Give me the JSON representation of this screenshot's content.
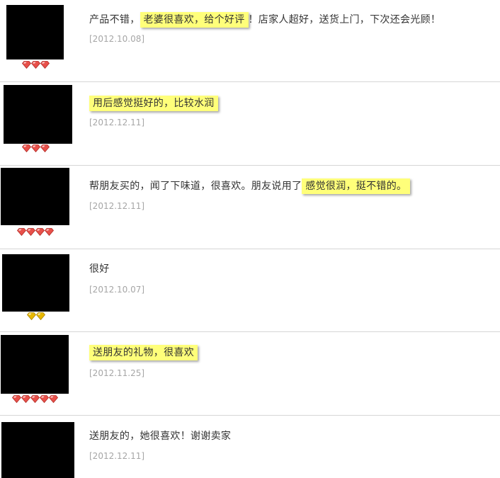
{
  "reviews": [
    {
      "parts": [
        "产品不错，",
        "老婆很喜欢，给个好评",
        "！店家人超好，送货上门，下次还会光顾！"
      ],
      "highlight_index": 1,
      "date": "[2012.10.08]",
      "badge": {
        "type": "red-diamond",
        "count": 3
      }
    },
    {
      "parts": [
        "",
        "用后感觉挺好的，比较水润",
        ""
      ],
      "highlight_index": 1,
      "date": "[2012.12.11]",
      "badge": {
        "type": "red-diamond",
        "count": 3
      }
    },
    {
      "parts": [
        "帮朋友买的，闻了下味道，很喜欢。朋友说用了",
        "感觉很润，挺不错的。",
        ""
      ],
      "highlight_index": 1,
      "date": "[2012.12.11]",
      "badge": {
        "type": "red-diamond",
        "count": 4
      }
    },
    {
      "parts": [
        "很好",
        "",
        ""
      ],
      "highlight_index": -1,
      "date": "[2012.10.07]",
      "badge": {
        "type": "yellow-diamond",
        "count": 2
      }
    },
    {
      "parts": [
        "",
        "送朋友的礼物，很喜欢",
        ""
      ],
      "highlight_index": 1,
      "date": "[2012.11.25]",
      "badge": {
        "type": "red-diamond",
        "count": 5
      }
    },
    {
      "parts": [
        "送朋友的，她很喜欢！谢谢卖家",
        "",
        ""
      ],
      "highlight_index": -1,
      "date": "[2012.12.11]",
      "badge": {
        "type": "red-diamond",
        "count": 0
      }
    }
  ],
  "colors": {
    "highlight": "#ffff7a",
    "gem_red": "#e8504a",
    "gem_yellow": "#e8b800",
    "date_gray": "#a6a6a6"
  }
}
